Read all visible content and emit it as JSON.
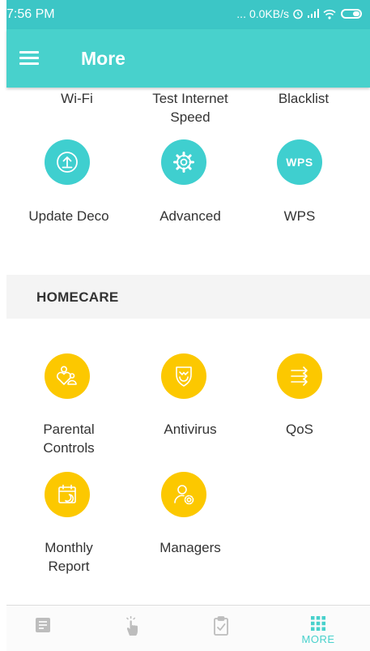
{
  "status_bar": {
    "time": "7:56 PM",
    "more": "...",
    "speed": "0.0KB/s"
  },
  "header": {
    "title": "More"
  },
  "network": {
    "top_labels": [
      "Wi-Fi",
      "Test Internet",
      "Speed",
      "Blacklist"
    ],
    "tiles": [
      {
        "icon": "upload-icon",
        "label": "Update Deco"
      },
      {
        "icon": "gear-icon",
        "label": "Advanced"
      },
      {
        "icon": "wps-icon",
        "icon_text": "WPS",
        "label": "WPS"
      }
    ]
  },
  "homecare": {
    "title": "HOMECARE",
    "tiles": [
      {
        "icon": "parental-controls-icon",
        "label_line1": "Parental",
        "label_line2": "Controls"
      },
      {
        "icon": "shield-icon",
        "label_line1": "Antivirus"
      },
      {
        "icon": "qos-icon",
        "label_line1": "QoS"
      },
      {
        "icon": "calendar-icon",
        "label_line1": "Monthly",
        "label_line2": "Report"
      },
      {
        "icon": "manager-icon",
        "label_line1": "Managers"
      }
    ]
  },
  "bottom_nav": {
    "items": [
      {
        "icon": "overview-icon"
      },
      {
        "icon": "touch-icon"
      },
      {
        "icon": "clipboard-icon"
      },
      {
        "icon": "grid-icon",
        "label": "MORE",
        "active": true
      }
    ]
  },
  "colors": {
    "accent": "#48d1cc",
    "teal_icon": "#3fcfcf",
    "homecare_icon": "#fcc800",
    "section_bg": "#f4f4f4"
  }
}
